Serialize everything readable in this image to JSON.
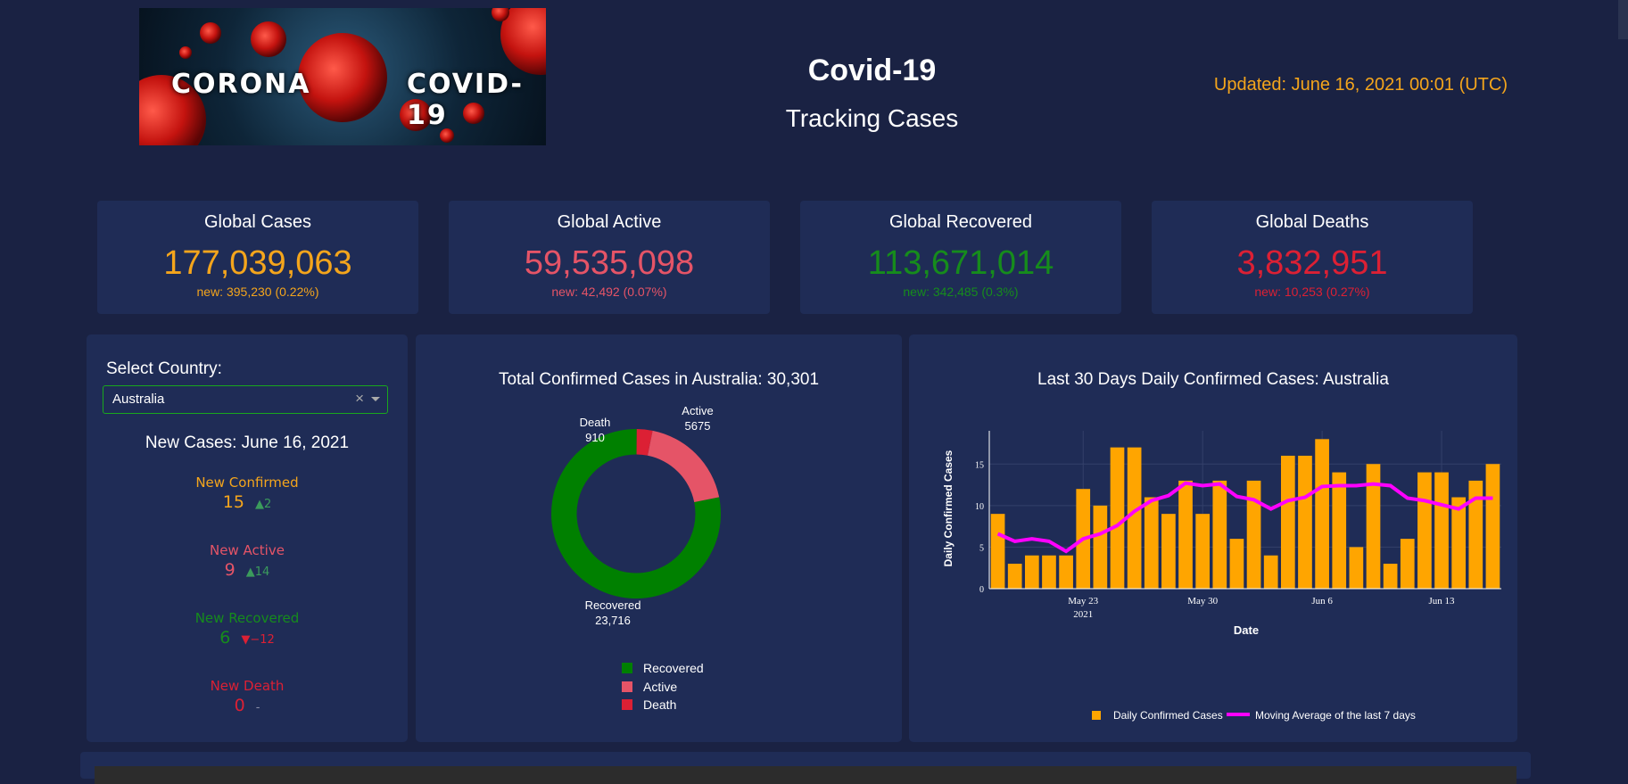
{
  "header": {
    "banner_left": "CORONA",
    "banner_right": "COVID-19",
    "title": "Covid-19",
    "subtitle": "Tracking Cases",
    "updated": "Updated: June 16, 2021 00:01 (UTC)"
  },
  "cards": [
    {
      "label": "Global Cases",
      "value": "177,039,063",
      "new": "new: 395,230 (0.22%)",
      "color": "#f4a51c"
    },
    {
      "label": "Global Active",
      "value": "59,535,098",
      "new": "new: 42,492 (0.07%)",
      "color": "#e55467"
    },
    {
      "label": "Global Recovered",
      "value": "113,671,014",
      "new": "new: 342,485 (0.3%)",
      "color": "#168c1c"
    },
    {
      "label": "Global Deaths",
      "value": "3,832,951",
      "new": "new: 10,253 (0.27%)",
      "color": "#dc2034"
    }
  ],
  "country_panel": {
    "select_label": "Select Country:",
    "selected_country": "Australia",
    "clear_glyph": "×",
    "new_cases_title": "New Cases: June 16, 2021",
    "stats": [
      {
        "label": "New Confirmed",
        "value": "15",
        "delta": "▲2",
        "color": "#f4a51c",
        "delta_color": "#3b9b5c"
      },
      {
        "label": "New Active",
        "value": "9",
        "delta": "▲14",
        "color": "#e55467",
        "delta_color": "#3b9b5c"
      },
      {
        "label": "New Recovered",
        "value": "6",
        "delta": "▼−12",
        "color": "#168c1c",
        "delta_color": "#dc2034"
      },
      {
        "label": "New Death",
        "value": "0",
        "delta": "-",
        "color": "#dc2034",
        "delta_color": "#8a8fa8"
      }
    ]
  },
  "chart_data": [
    {
      "type": "pie",
      "title": "Total Confirmed Cases in Australia: 30,301",
      "labels": [
        "Recovered",
        "Active",
        "Death"
      ],
      "values": [
        23716,
        5675,
        910
      ],
      "value_labels": [
        "23,716",
        "5675",
        "910"
      ],
      "colors": [
        "#008000",
        "#e55467",
        "#dc2034"
      ],
      "hole": 0.7,
      "legend": "bottom"
    },
    {
      "type": "bar",
      "title": "Last 30 Days Daily Confirmed Cases: Australia",
      "xlabel": "Date",
      "ylabel": "Daily Confirmed Cases",
      "x_start": "2021-05-18",
      "x_ticks": [
        "May 23",
        "May 30",
        "Jun 6",
        "Jun 13"
      ],
      "x_tick_year": "2021",
      "y_ticks": [
        "0",
        "5",
        "10",
        "15"
      ],
      "ylim": [
        0,
        19
      ],
      "grid": true,
      "legend": "bottom",
      "series": [
        {
          "name": "Daily Confirmed Cases",
          "type": "bar",
          "color": "#ffa500",
          "values": [
            9,
            3,
            4,
            4,
            4,
            12,
            10,
            17,
            17,
            11,
            9,
            13,
            9,
            13,
            6,
            13,
            4,
            16,
            16,
            18,
            14,
            5,
            15,
            3,
            6,
            14,
            14,
            11,
            13,
            15
          ]
        },
        {
          "name": "Moving Average of the last 7 days",
          "type": "line",
          "color": "#ff00ff",
          "values": [
            6.6,
            5.7,
            6.0,
            5.7,
            4.5,
            6.0,
            6.6,
            7.6,
            9.3,
            10.6,
            11.2,
            12.7,
            12.4,
            12.6,
            11.1,
            10.7,
            9.6,
            10.6,
            11.0,
            12.3,
            12.4,
            12.4,
            12.6,
            12.4,
            10.9,
            10.6,
            10.1,
            9.6,
            10.9,
            10.9
          ]
        }
      ]
    }
  ]
}
